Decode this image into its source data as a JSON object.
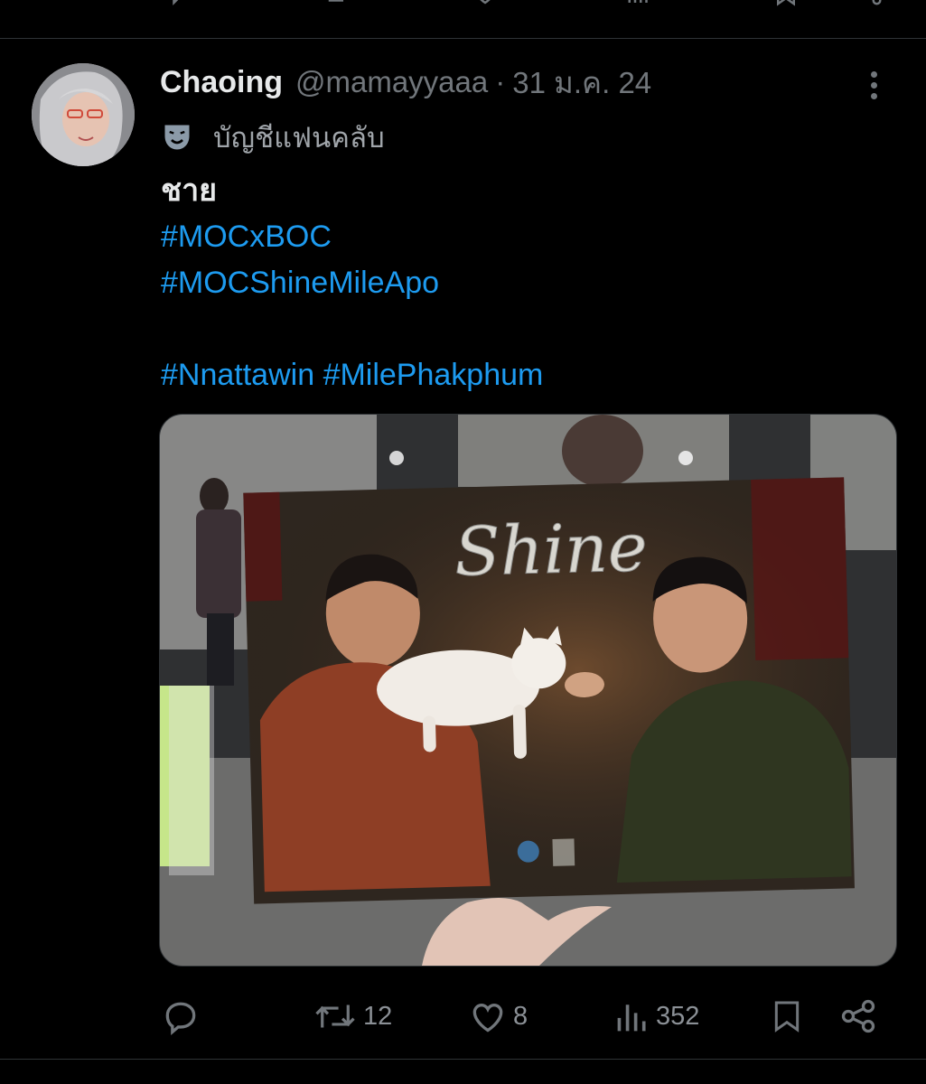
{
  "previous_tweet": {
    "actions_cut_off": true
  },
  "tweet": {
    "author": {
      "display_name": "Chaoing",
      "handle": "@mamayyaaa",
      "separator": "·",
      "date": "31 ม.ค. 24",
      "badge_icon": "theater-masks-icon",
      "badge_label": "บัญชีแฟนคลับ"
    },
    "text": {
      "line1": "ชาย",
      "hashtag1": "#MOCxBOC",
      "hashtag2": "#MOCShineMileApo",
      "hashtag3": "#Nnattawin",
      "hashtag4": "#MilePhakphum"
    },
    "media": {
      "poster_title": "Shine"
    },
    "actions": {
      "reply_count": "",
      "retweet_count": "12",
      "like_count": "8",
      "views_count": "352"
    }
  },
  "colors": {
    "background": "#000000",
    "link": "#1d9bf0",
    "muted": "#71767b",
    "text": "#e7e9ea"
  }
}
